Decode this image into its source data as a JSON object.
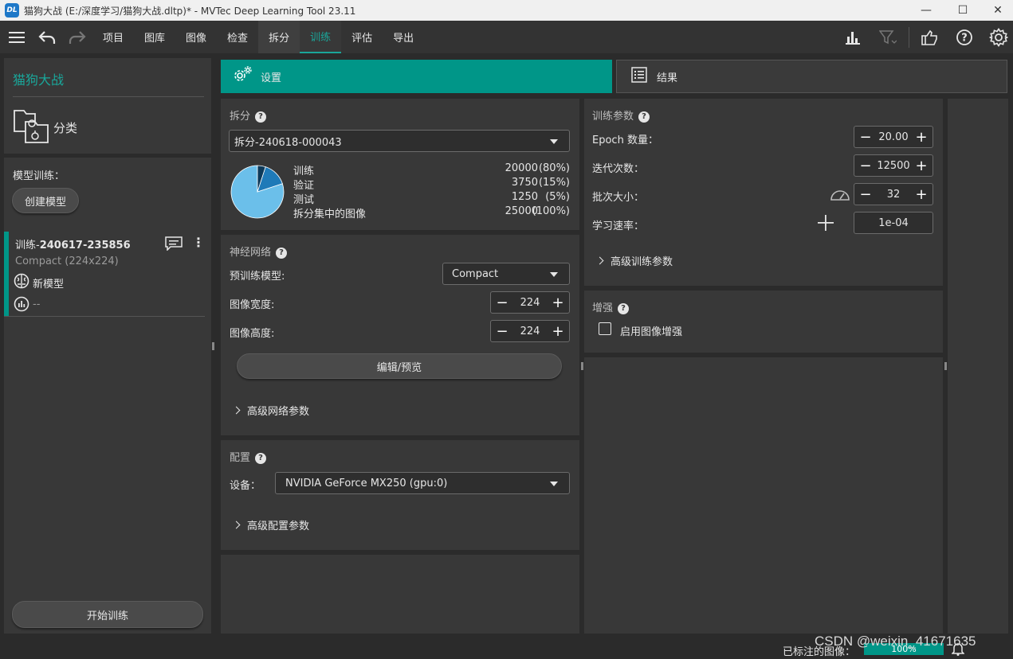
{
  "window": {
    "title": "猫狗大战 (E:/深度学习/猫狗大战.dltp)* - MVTec Deep Learning Tool 23.11",
    "logo": "DL",
    "minimize": "—",
    "maximize": "☐",
    "close": "✕"
  },
  "menu": [
    "项目",
    "图库",
    "图像",
    "检查",
    "拆分",
    "训练",
    "评估",
    "导出"
  ],
  "sidebar": {
    "project_name": "猫狗大战",
    "task_label": "分类",
    "model_training_label": "模型训练：",
    "create_model_label": "创建模型",
    "training_run": {
      "name_prefix": "训练-",
      "name_id": "240617-235856",
      "network": "Compact (224x224)",
      "model_label": "新模型",
      "result": "--"
    },
    "start_training_label": "开始训练"
  },
  "tabs": {
    "settings": "设置",
    "results": "结果"
  },
  "split": {
    "title": "拆分",
    "selected": "拆分-240618-000043",
    "rows": [
      {
        "label": "训练",
        "value": "20000",
        "pct": "(80%)"
      },
      {
        "label": "验证",
        "value": "3750",
        "pct": "(15%)"
      },
      {
        "label": "测试",
        "value": "1250",
        "pct": "(5%)"
      },
      {
        "label": "拆分集中的图像",
        "value": "25000",
        "pct": "(100%)"
      }
    ],
    "pie": [
      {
        "name": "训练",
        "fraction": 0.8,
        "color": "#6bbfea"
      },
      {
        "name": "验证",
        "fraction": 0.15,
        "color": "#1f7ab8"
      },
      {
        "name": "测试",
        "fraction": 0.05,
        "color": "#0d3a5a"
      }
    ]
  },
  "network": {
    "title": "神经网络",
    "pretrained_label": "预训练模型:",
    "pretrained_value": "Compact",
    "width_label": "图像宽度:",
    "width_value": "224",
    "height_label": "图像高度:",
    "height_value": "224",
    "edit_label": "编辑/预览",
    "advanced_label": "高级网络参数"
  },
  "config": {
    "title": "配置",
    "device_label": "设备：",
    "device_value": "NVIDIA GeForce MX250 (gpu:0)",
    "advanced_label": "高级配置参数"
  },
  "train_params": {
    "title": "训练参数",
    "epoch_label": "Epoch 数量：",
    "epoch_value": "20.00",
    "iter_label": "迭代次数：",
    "iter_value": "12500",
    "batch_label": "批次大小：",
    "batch_value": "32",
    "lr_label": "学习速率：",
    "lr_value": "1e-04",
    "advanced_label": "高级训练参数"
  },
  "augment": {
    "title": "增强",
    "enable_label": "启用图像增强"
  },
  "statusbar": {
    "annotated_label": "已标注的图像：",
    "annotated_progress": "100%",
    "watermark": "CSDN @weixin_41671635"
  },
  "colors": {
    "accent": "#009688",
    "teal_text": "#1aa69a"
  }
}
